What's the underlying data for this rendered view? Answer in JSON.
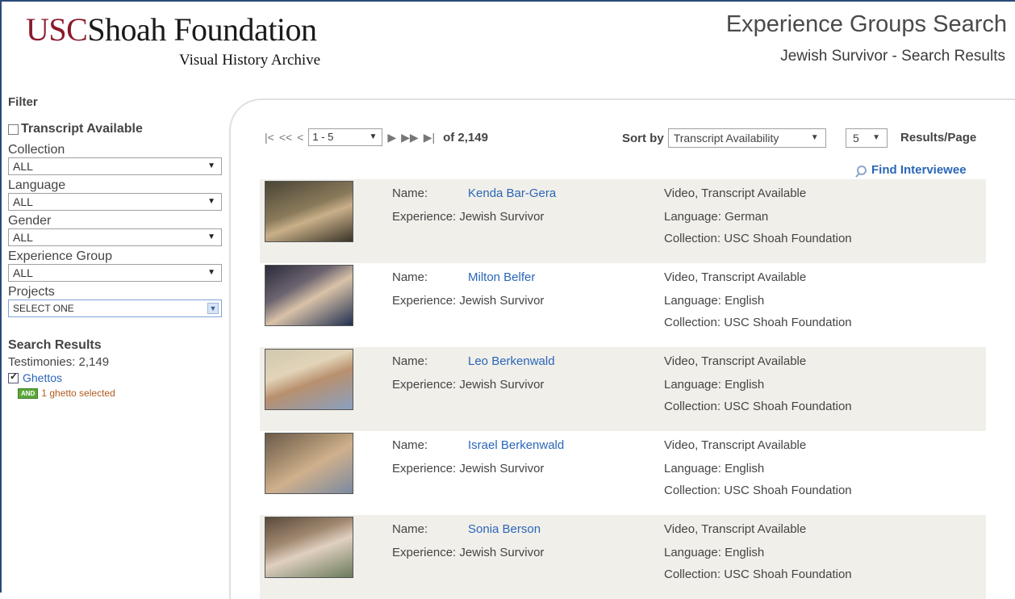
{
  "header": {
    "logo_usc": "USC",
    "logo_rest": "Shoah Foundation",
    "logo_sub": "Visual History Archive",
    "title": "Experience Groups Search",
    "subtitle": "Jewish Survivor - Search Results"
  },
  "sidebar": {
    "filter_heading": "Filter",
    "transcript_checkbox": "Transcript Available",
    "collection": {
      "label": "Collection",
      "value": "ALL"
    },
    "language": {
      "label": "Language",
      "value": "ALL"
    },
    "gender": {
      "label": "Gender",
      "value": "ALL"
    },
    "experience_group": {
      "label": "Experience Group",
      "value": "ALL"
    },
    "projects": {
      "label": "Projects",
      "value": "SELECT ONE"
    },
    "results_title": "Search Results",
    "testimonies": "Testimonies: 2,149",
    "ghettos": "Ghettos",
    "and_badge": "AND",
    "ghetto_selected": "1 ghetto selected"
  },
  "toolbar": {
    "page_range": "1 - 5",
    "of_total": "of 2,149",
    "sort_label": "Sort by",
    "sort_value": "Transcript Availability",
    "rpp_value": "5",
    "rpp_label": "Results/Page",
    "find_interviewee": "Find Interviewee"
  },
  "results": [
    {
      "name_label": "Name:",
      "name": "Kenda Bar-Gera",
      "experience": "Experience: Jewish Survivor",
      "media": "Video, Transcript Available",
      "language": "Language: German",
      "collection": "Collection: USC Shoah Foundation"
    },
    {
      "name_label": "Name:",
      "name": "Milton Belfer",
      "experience": "Experience: Jewish Survivor",
      "media": "Video, Transcript Available",
      "language": "Language: English",
      "collection": "Collection: USC Shoah Foundation"
    },
    {
      "name_label": "Name:",
      "name": "Leo Berkenwald",
      "experience": "Experience: Jewish Survivor",
      "media": "Video, Transcript Available",
      "language": "Language: English",
      "collection": "Collection: USC Shoah Foundation"
    },
    {
      "name_label": "Name:",
      "name": "Israel Berkenwald",
      "experience": "Experience: Jewish Survivor",
      "media": "Video, Transcript Available",
      "language": "Language: English",
      "collection": "Collection: USC Shoah Foundation"
    },
    {
      "name_label": "Name:",
      "name": "Sonia Berson",
      "experience": "Experience: Jewish Survivor",
      "media": "Video, Transcript Available",
      "language": "Language: English",
      "collection": "Collection: USC Shoah Foundation"
    }
  ],
  "colors": {
    "brand_red": "#8a1a2c",
    "link_blue": "#2a66b8",
    "alt_row": "#f1efea",
    "frame": "#2b4a7a"
  }
}
